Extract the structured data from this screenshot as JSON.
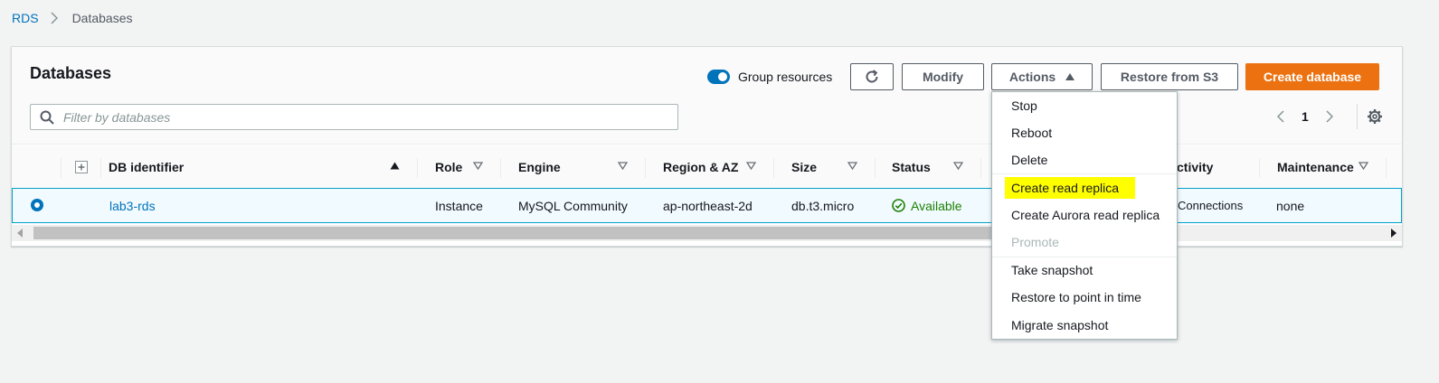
{
  "breadcrumb": {
    "root": "RDS",
    "current": "Databases"
  },
  "panel": {
    "title": "Databases",
    "group_resources_label": "Group resources",
    "group_resources_on": true,
    "buttons": {
      "refresh_icon": "refresh-icon",
      "modify": "Modify",
      "actions": "Actions",
      "restore": "Restore from S3",
      "create": "Create database"
    },
    "accent_color": "#ec7211",
    "link_color": "#0073bb",
    "search_placeholder": "Filter by databases",
    "pagination": {
      "page": "1"
    }
  },
  "table": {
    "columns": [
      {
        "label": "DB identifier",
        "sort": "ascending"
      },
      {
        "label": "Role",
        "sort": "none"
      },
      {
        "label": "Engine",
        "sort": "none"
      },
      {
        "label": "Region & AZ",
        "sort": "none"
      },
      {
        "label": "Size",
        "sort": "none"
      },
      {
        "label": "Status",
        "sort": "none"
      },
      {
        "label": "ctivity",
        "sort": "none"
      },
      {
        "label": "Maintenance",
        "sort": "none"
      }
    ],
    "rows": [
      {
        "selected": true,
        "identifier": "lab3-rds",
        "role": "Instance",
        "engine": "MySQL Community",
        "region": "ap-northeast-2d",
        "size": "db.t3.micro",
        "status": "Available",
        "status_color": "#1d8102",
        "activity": "Connections",
        "maintenance": "none"
      }
    ]
  },
  "actions_menu": {
    "items": [
      {
        "label": "Stop",
        "enabled": true
      },
      {
        "label": "Reboot",
        "enabled": true
      },
      {
        "label": "Delete",
        "enabled": true
      },
      {
        "label": "Create read replica",
        "enabled": true,
        "highlighted": true
      },
      {
        "label": "Create Aurora read replica",
        "enabled": true
      },
      {
        "label": "Promote",
        "enabled": false
      },
      {
        "label": "Take snapshot",
        "enabled": true
      },
      {
        "label": "Restore to point in time",
        "enabled": true
      },
      {
        "label": "Migrate snapshot",
        "enabled": true
      }
    ],
    "highlight_color": "#ffff00"
  }
}
